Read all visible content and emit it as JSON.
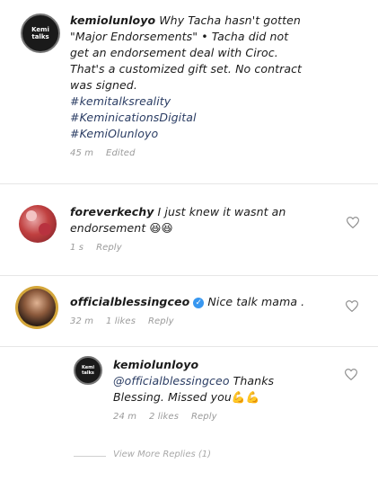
{
  "comments": [
    {
      "username": "kemiolunloyo",
      "text_lines": [
        "Why Tacha hasn't gotten",
        "\"Major Endorsements\" • Tacha did not",
        "get an endorsement deal with Ciroc.",
        "That's a customized gift set. No contract",
        "was signed."
      ],
      "hashtags": [
        "#kemitalksreality",
        "#KeminicationsDigital",
        "#KemiOlunloyo"
      ],
      "time": "45 m",
      "edited": "Edited"
    },
    {
      "username": "foreverkechy",
      "text_line1": "I just knew it wasnt an",
      "text_line2": "endorsement",
      "emoji": "😆😆",
      "time": "1 s",
      "reply_label": "Reply"
    },
    {
      "username": "officialblessingceo",
      "text": "Nice talk mama .",
      "time": "32 m",
      "likes": "1 likes",
      "reply_label": "Reply"
    },
    {
      "username": "kemiolunloyo",
      "mention": "@officialblessingceo",
      "text_after_mention": "Thanks",
      "text_line2": "Blessing. Missed you",
      "emoji": "💪💪",
      "time": "24 m",
      "likes": "2 likes",
      "reply_label": "Reply"
    }
  ],
  "view_more": "View More Replies (1)",
  "avatar_text": "Kemi talks",
  "colors": {
    "verified": "#3897f0",
    "hashtag": "#2a3c63",
    "meta": "#9a9a9a"
  }
}
